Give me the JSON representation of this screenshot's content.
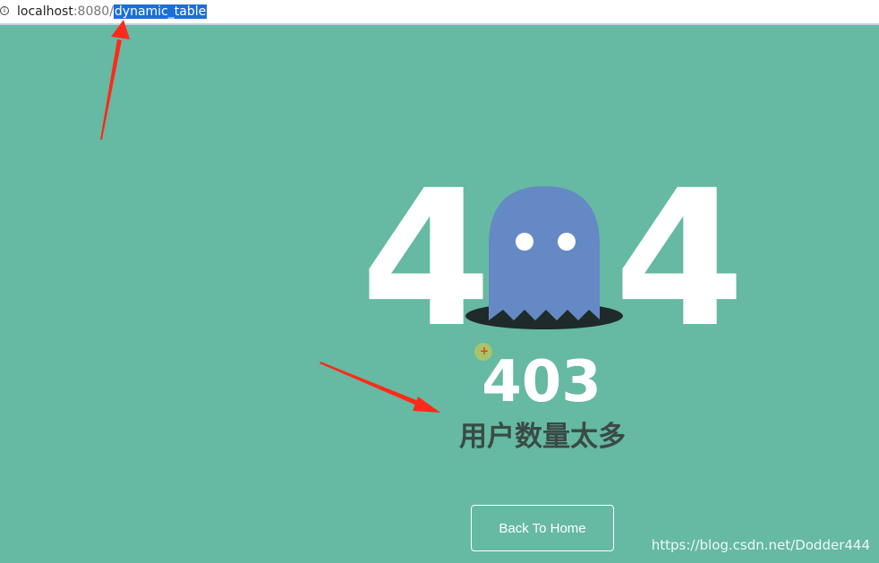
{
  "address_bar": {
    "host": "localhost",
    "port": ":8080/",
    "selected_path": "dynamic_table",
    "info_icon": "info-icon"
  },
  "illustration": {
    "digit_left": "4",
    "digit_right": "4",
    "ghost": "ghost-icon",
    "colors": {
      "ghost": "#6589c4",
      "hole": "#1f2a2a",
      "digits": "#ffffff",
      "background": "#66b9a2"
    }
  },
  "status": {
    "code": "403",
    "message": "用户数量太多"
  },
  "actions": {
    "back_home_label": "Back To Home"
  },
  "annotations": {
    "arrow_color": "#ff2a1a"
  },
  "watermark": "https://blog.csdn.net/Dodder444"
}
